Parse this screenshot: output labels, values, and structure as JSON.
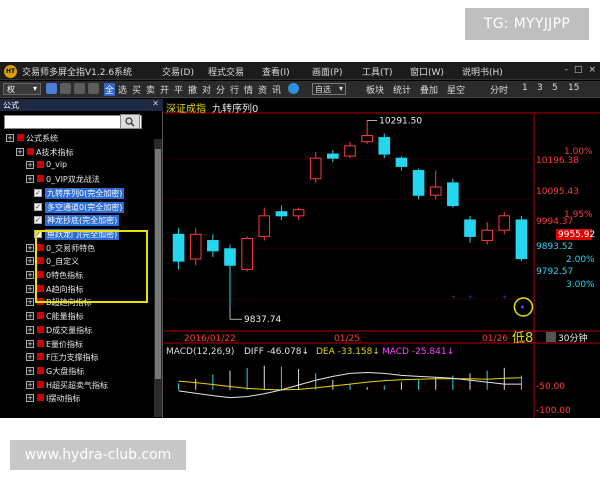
{
  "watermarks": {
    "top": "TG: MYYJJPP",
    "bottom": "www.hydra-club.com"
  },
  "window": {
    "title": "交易师多屏全指V1.2.6系统",
    "menu": [
      "交易(D)",
      "程式交易",
      "查看(I)",
      "画面(P)",
      "工具(T)",
      "窗口(W)",
      "说明书(H)"
    ],
    "controls": [
      "-",
      "□",
      "×"
    ]
  },
  "toolbar": {
    "left_select": "权",
    "items": [
      "全",
      "选",
      "买",
      "卖",
      "开",
      "平",
      "撤",
      "对",
      "分",
      "行",
      "情",
      "资",
      "讯",
      "自选",
      "板块",
      "统计",
      "叠加",
      "星空",
      "分时",
      "1",
      "3",
      "5",
      "15"
    ]
  },
  "left_panel": {
    "title": "公式",
    "close": "✕",
    "tree": [
      {
        "label": "公式系统",
        "indent": 0
      },
      {
        "label": "A技术指标",
        "indent": 1
      },
      {
        "label": "0_vip",
        "indent": 2
      },
      {
        "label": "0_VIP双龙战法",
        "indent": 2
      },
      {
        "label": "九转序列0(完全加密)",
        "indent": 3,
        "selected": true
      },
      {
        "label": "多空通道0(完全加密)",
        "indent": 3,
        "selected": true
      },
      {
        "label": "神龙抄底(完全加密)",
        "indent": 3,
        "selected": true
      },
      {
        "label": "鱼跃龙门(完全加密)",
        "indent": 3,
        "selected": true
      },
      {
        "label": "0_交易师特色",
        "indent": 2
      },
      {
        "label": "0_自定义",
        "indent": 2
      },
      {
        "label": "0特色指标",
        "indent": 2
      },
      {
        "label": "A趋向指标",
        "indent": 2
      },
      {
        "label": "B超趋向指标",
        "indent": 2
      },
      {
        "label": "C能量指标",
        "indent": 2
      },
      {
        "label": "D成交量指标",
        "indent": 2
      },
      {
        "label": "E量价指标",
        "indent": 2
      },
      {
        "label": "F压力支撑指标",
        "indent": 2
      },
      {
        "label": "G大盘指标",
        "indent": 2
      },
      {
        "label": "H超买超卖气指标",
        "indent": 2
      },
      {
        "label": "I摆动指标",
        "indent": 2
      }
    ]
  },
  "chart": {
    "symbol": "深证成指",
    "indicator": "九转序列0",
    "high_label": "10291.50",
    "low_label": "9837.74",
    "date_labels": [
      "2016/01/22",
      "01/25",
      "01/26"
    ],
    "low_signal": "低8",
    "period_button": "30分钟",
    "price_axis": [
      {
        "pct": "1.00%",
        "price": "10196.38"
      },
      {
        "pct": "",
        "price": "10095.43"
      },
      {
        "pct": "1.00%",
        "price": "9994.37"
      },
      {
        "pct": "",
        "price": "9955.92"
      },
      {
        "pct": "2.00%",
        "price": "9893.52"
      },
      {
        "pct": "3.00%",
        "price": "9792.57"
      }
    ],
    "price_axis_top_pct": "1.00%",
    "price_axis_mid_pct": "1.95%",
    "macd_header": {
      "name": "MACD(12,26,9)",
      "diff": "DIFF -46.078↓",
      "dea": "DEA -33.158↓",
      "macd": "MACD -25.841↓"
    },
    "macd_axis": [
      "-50.00",
      "-100.00"
    ],
    "colors": {
      "up": "#ff3b3b",
      "down": "#25d6ee",
      "diff": "#e6e6e6",
      "dea": "#e6d600",
      "macd": "#ff44ff",
      "current_price_bg": "#e00000"
    }
  },
  "chart_data": {
    "type": "candlestick",
    "title": "深证成指 九转序列0",
    "x": [
      "2016/01/22",
      "01/25",
      "01/26"
    ],
    "candles": [
      {
        "open": 10015,
        "close": 9950,
        "high": 10030,
        "low": 9930
      },
      {
        "open": 9955,
        "close": 10015,
        "high": 10030,
        "low": 9940
      },
      {
        "open": 10000,
        "close": 9975,
        "high": 10015,
        "low": 9960
      },
      {
        "open": 9980,
        "close": 9940,
        "high": 9990,
        "low": 9838
      },
      {
        "open": 9930,
        "close": 10005,
        "high": 10010,
        "low": 9925
      },
      {
        "open": 10010,
        "close": 10060,
        "high": 10080,
        "low": 10000
      },
      {
        "open": 10070,
        "close": 10060,
        "high": 10085,
        "low": 10050
      },
      {
        "open": 10060,
        "close": 10075,
        "high": 10080,
        "low": 10050
      },
      {
        "open": 10150,
        "close": 10200,
        "high": 10215,
        "low": 10140
      },
      {
        "open": 10210,
        "close": 10200,
        "high": 10220,
        "low": 10190
      },
      {
        "open": 10205,
        "close": 10230,
        "high": 10240,
        "low": 10200
      },
      {
        "open": 10240,
        "close": 10255,
        "high": 10291.5,
        "low": 10235
      },
      {
        "open": 10250,
        "close": 10210,
        "high": 10260,
        "low": 10200
      },
      {
        "open": 10200,
        "close": 10180,
        "high": 10205,
        "low": 10170
      },
      {
        "open": 10170,
        "close": 10110,
        "high": 10175,
        "low": 10100
      },
      {
        "open": 10110,
        "close": 10130,
        "high": 10170,
        "low": 10100
      },
      {
        "open": 10140,
        "close": 10085,
        "high": 10150,
        "low": 10080
      },
      {
        "open": 10050,
        "close": 10010,
        "high": 10060,
        "low": 9995
      },
      {
        "open": 10000,
        "close": 10025,
        "high": 10045,
        "low": 9990
      },
      {
        "open": 10025,
        "close": 10060,
        "high": 10070,
        "low": 10015
      },
      {
        "open": 10050,
        "close": 9956,
        "high": 10060,
        "low": 9950
      }
    ],
    "ylim": [
      9790,
      10300
    ],
    "macd_hist": [
      -12,
      -20,
      -28,
      -35,
      -40,
      -44,
      -42,
      -38,
      -30,
      -18,
      -10,
      -5,
      -8,
      -14,
      -18,
      -22,
      -26,
      -30,
      -35,
      -40,
      -26
    ],
    "diff": [
      -60,
      -65,
      -70,
      -74,
      -72,
      -66,
      -58,
      -48,
      -38,
      -30,
      -24,
      -22,
      -24,
      -28,
      -30,
      -32,
      -34,
      -38,
      -42,
      -46,
      -46
    ],
    "dea": [
      -40,
      -43,
      -47,
      -51,
      -55,
      -57,
      -58,
      -57,
      -54,
      -50,
      -46,
      -42,
      -39,
      -37,
      -36,
      -35,
      -35,
      -35,
      -36,
      -34,
      -33
    ],
    "macd_ylim": [
      -110,
      10
    ]
  }
}
